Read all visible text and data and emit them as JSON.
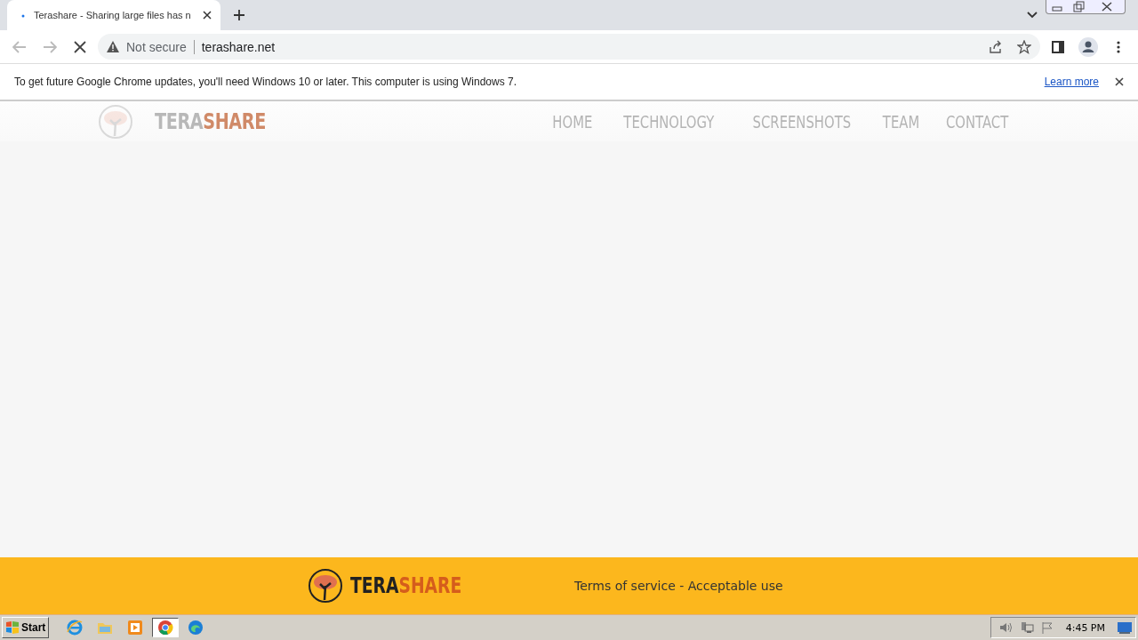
{
  "browser": {
    "tab": {
      "title": "Terashare - Sharing large files has n",
      "loading": true
    },
    "address": {
      "security": "Not secure",
      "url": "terashare.net"
    },
    "infobar": {
      "message": "To get future Google Chrome updates, you'll need Windows 10 or later. This computer is using Windows 7.",
      "link": "Learn more"
    }
  },
  "site": {
    "logo": {
      "part_1": "TERA",
      "part_2": "SHARE"
    },
    "nav": [
      {
        "label": "HOME"
      },
      {
        "label": "TECHNOLOGY"
      },
      {
        "label": "SCREENSHOTS"
      },
      {
        "label": "TEAM"
      },
      {
        "label": "CONTACT"
      }
    ],
    "footer": {
      "logo": {
        "part_1": "TERA",
        "part_2": "SHARE"
      },
      "links": "Terms of service - Acceptable use"
    }
  },
  "taskbar": {
    "start": "Start",
    "apps": [
      {
        "kind": "ie",
        "selected": false
      },
      {
        "kind": "folder",
        "selected": false
      },
      {
        "kind": "media",
        "selected": false
      },
      {
        "kind": "chrome",
        "selected": true
      },
      {
        "kind": "edge",
        "selected": false
      }
    ],
    "clock": "4:45 PM"
  }
}
